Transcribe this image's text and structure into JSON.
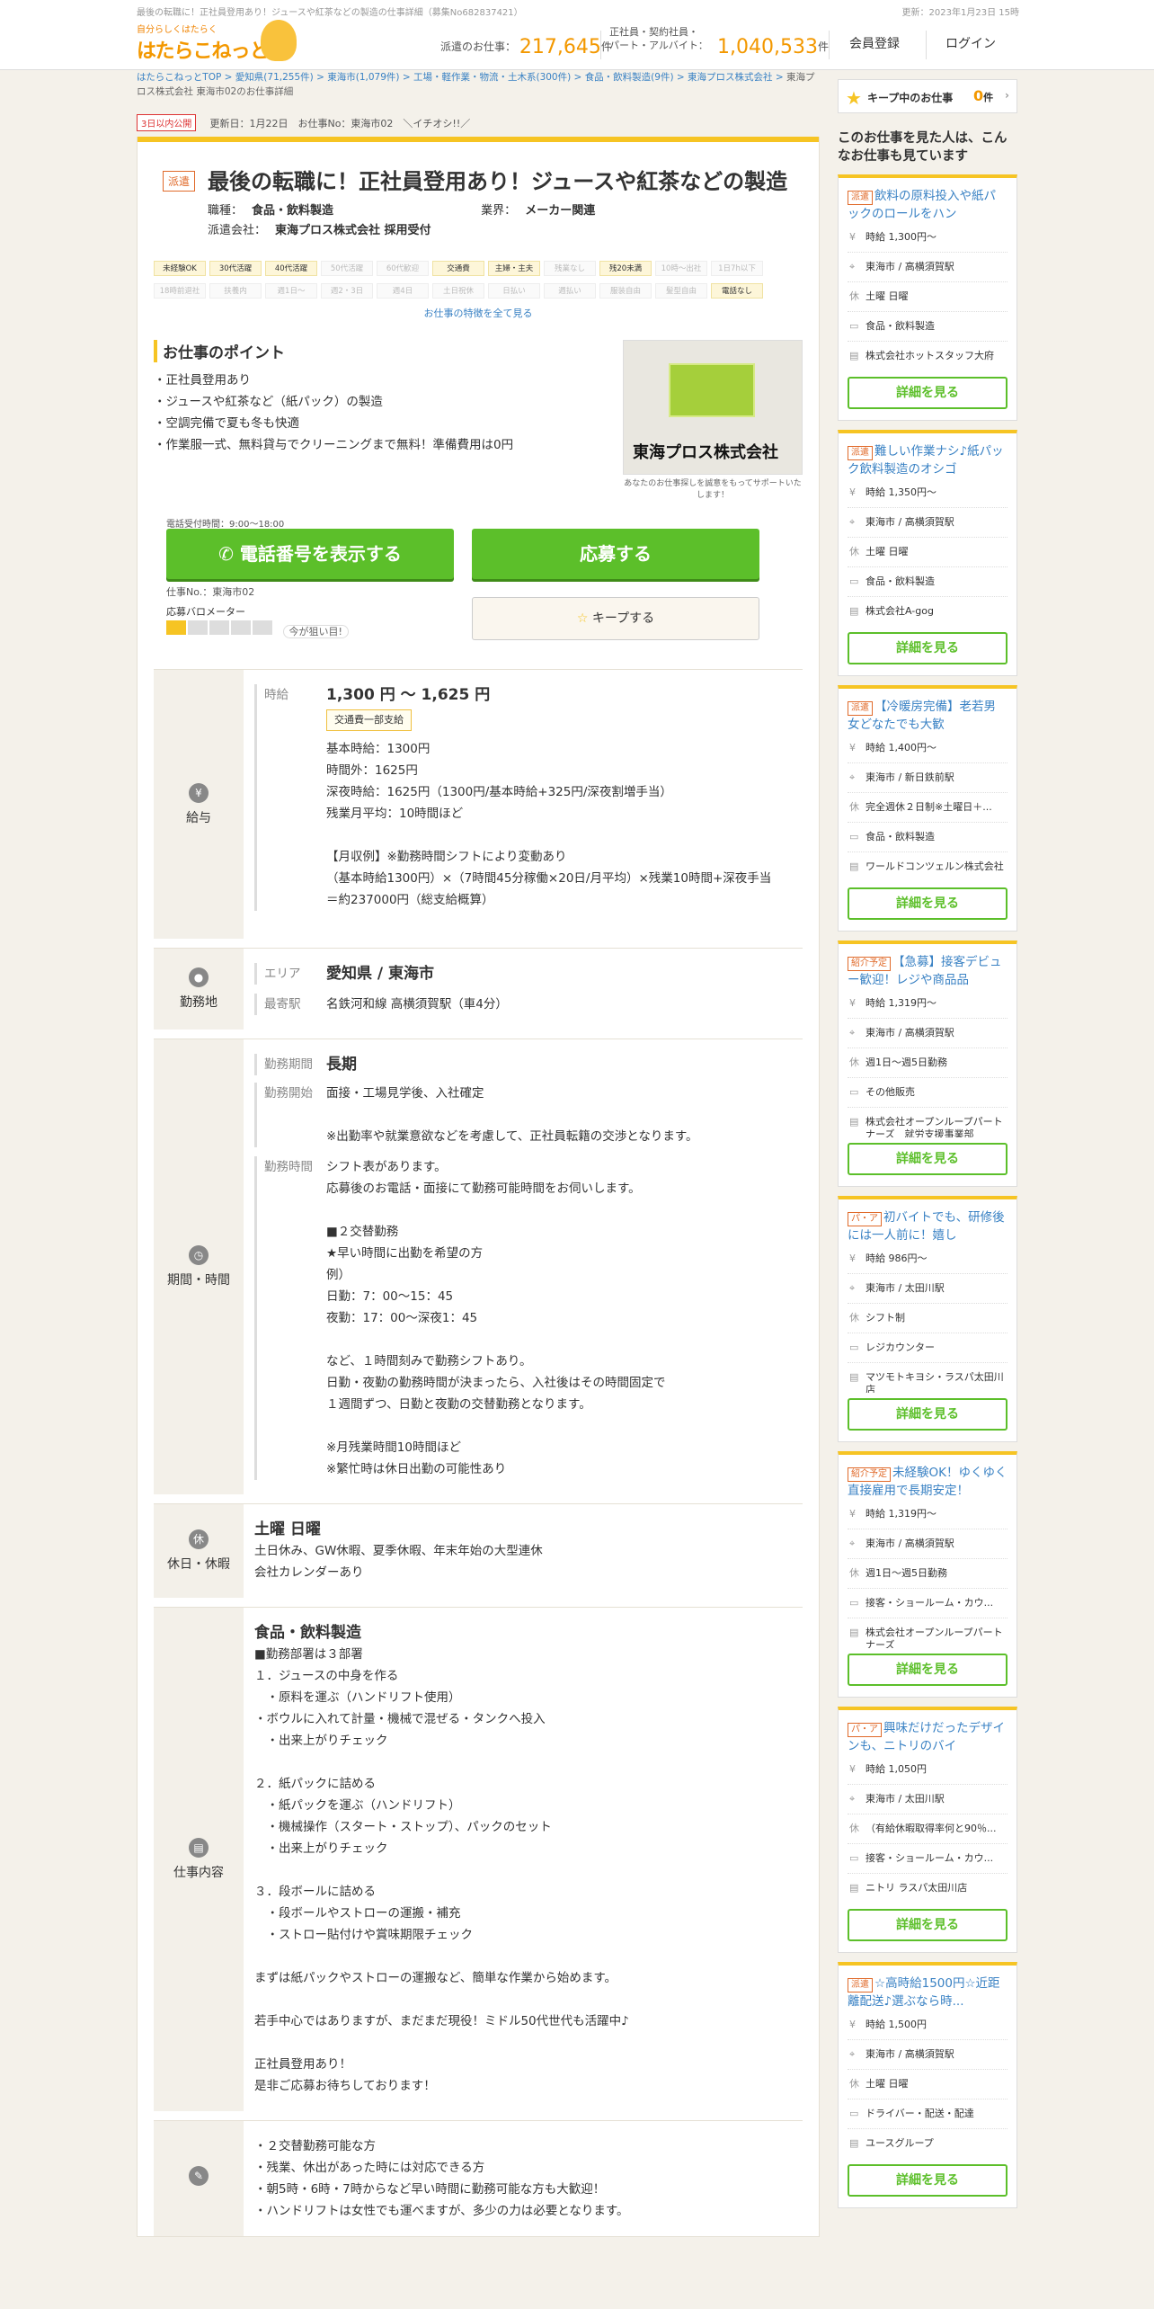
{
  "topbar": {
    "left": "最後の転職に！正社員登用あり！ジュースや紅茶などの製造の仕事詳細（募集No682837421）",
    "right": "更新：2023年1月23日 15時"
  },
  "header": {
    "logo_small": "自分らしくはたらく",
    "logo": "はたらこねっと",
    "haken_label": "派遣のお仕事：",
    "haken_num": "217,645",
    "unit": "件",
    "seishain_label1": "正社員・契約社員・",
    "seishain_label2": "パート・アルバイト：",
    "seishain_num": "1,040,533",
    "register": "会員登録",
    "login": "ログイン"
  },
  "breadcrumb": {
    "links": [
      "はたらこねっとTOP",
      "愛知県(71,255件)",
      "東海市(1,079件)",
      "工場・軽作業・物流・土木系(300件)",
      "食品・飲料製造(9件)",
      "東海プロス株式会社",
      "東海プロス株式会社 東海市02のお仕事詳細"
    ],
    "sep": " > "
  },
  "job": {
    "newtag": "3日以内公開",
    "updated": "更新日：1月22日　お仕事No：東海市02　＼イチオシ!!／",
    "kind": "派遣",
    "title": "最後の転職に！正社員登用あり！ジュースや紅茶などの製造",
    "job_label": "職種：",
    "job_value": "食品・飲料製造",
    "industry_label": "業界：",
    "industry_value": "メーカー関連",
    "company_label": "派遣会社：",
    "company_value": "東海プロス株式会社 採用受付",
    "features": [
      [
        "未経験OK",
        1
      ],
      [
        "30代活躍",
        1
      ],
      [
        "40代活躍",
        1
      ],
      [
        "50代活躍",
        0
      ],
      [
        "60代歓迎",
        0
      ],
      [
        "交通費",
        1
      ],
      [
        "主婦・主夫",
        1
      ],
      [
        "残業なし",
        0
      ],
      [
        "残20未満",
        1
      ],
      [
        "10時～出社",
        0
      ],
      [
        "1日7h以下",
        0
      ],
      [
        "18時前退社",
        0
      ],
      [
        "扶養内",
        0
      ],
      [
        "週1日～",
        0
      ],
      [
        "週2・3日",
        0
      ],
      [
        "週4日",
        0
      ],
      [
        "土日祝休",
        0
      ],
      [
        "日払い",
        0
      ],
      [
        "週払い",
        0
      ],
      [
        "服装自由",
        0
      ],
      [
        "髪型自由",
        0
      ],
      [
        "電話なし",
        1
      ]
    ],
    "more": "お仕事の特徴を全て見る",
    "point_title": "お仕事のポイント",
    "points": [
      "・正社員登用あり",
      "・ジュースや紅茶など（紙パック）の製造",
      "・空調完備で夏も冬も快適",
      "・作業服一式、無料貸与でクリーニングまで無料！準備費用は0円"
    ],
    "comp_logo_text": "東海プロス株式会社",
    "comp_caption": "あなたのお仕事探しを誠意をもってサポートいたします！",
    "tel_hours": "電話受付時間：9:00～18:00",
    "tel_btn": "電話番号を表示する",
    "apply_btn": "応募する",
    "jobno": "仕事No.：東海市02",
    "baro_label": "応募バロメーター",
    "baro_level": 1,
    "baro_note": "今が狙い目!",
    "keep_btn": "キープする"
  },
  "sections": {
    "salary": {
      "head": "給与",
      "lab": "時給",
      "range": "1,300 円 ～ 1,625 円",
      "pill": "交通費一部支給",
      "lines": [
        "基本時給：1300円",
        "時間外：1625円",
        "深夜時給：1625円（1300円/基本時給+325円/深夜割増手当）",
        "残業月平均：10時間ほど",
        "",
        "【月収例】※勤務時間シフトにより変動あり",
        "（基本時給1300円）×（7時間45分稼働×20日/月平均）×残業10時間+深夜手当",
        "＝約237000円（総支給概算）"
      ]
    },
    "place": {
      "head": "勤務地",
      "lab1": "エリア",
      "area": "愛知県 / 東海市",
      "lab2": "最寄駅",
      "station": "名鉄河和線 高横須賀駅（車4分）"
    },
    "period": {
      "head": "期間・時間",
      "lab1": "勤務期間",
      "term": "長期",
      "lab2": "勤務開始",
      "start": [
        "面接・工場見学後、入社確定",
        "",
        "※出勤率や就業意欲などを考慮して、正社員転籍の交渉となります。"
      ],
      "lab3": "勤務時間",
      "hours": [
        "シフト表があります。",
        "応募後のお電話・面接にて勤務可能時間をお伺いします。",
        "",
        "■２交替勤務",
        "★早い時間に出勤を希望の方",
        "例）",
        "日勤：7：00～15：45",
        "夜勤：17：00～深夜1：45",
        "",
        "など、１時間刻みで勤務シフトあり。",
        "日勤・夜勤の勤務時間が決まったら、入社後はその時間固定で",
        "１週間ずつ、日勤と夜勤の交替勤務となります。",
        "",
        "※月残業時間10時間ほど",
        "※繁忙時は休日出勤の可能性あり"
      ]
    },
    "holiday": {
      "head": "休日・休暇",
      "icon": "休",
      "title": "土曜 日曜",
      "lines": [
        "土日休み、GW休暇、夏季休暇、年末年始の大型連休",
        "会社カレンダーあり"
      ]
    },
    "work": {
      "head": "仕事内容",
      "title": "食品・飲料製造",
      "lines": [
        "■勤務部署は３部署",
        "１．ジュースの中身を作る",
        "　・原料を運ぶ（ハンドリフト使用）",
        "・ボウルに入れて計量・機械で混ぜる・タンクへ投入",
        "　・出来上がりチェック",
        "",
        "２．紙パックに詰める",
        "　・紙パックを運ぶ（ハンドリフト）",
        "　・機械操作（スタート・ストップ）、パックのセット",
        "　・出来上がりチェック",
        "",
        "３．段ボールに詰める",
        "　・段ボールやストローの運搬・補充",
        "　・ストロー貼付けや賞味期限チェック",
        "",
        "まずは紙パックやストローの運搬など、簡単な作業から始めます。",
        "",
        "若手中心ではありますが、まだまだ現役！ミドル50代世代も活躍中♪",
        "",
        "正社員登用あり！",
        "是非ご応募お待ちしております！"
      ]
    },
    "extra": {
      "lines": [
        "・２交替勤務可能な方",
        "・残業、休出があった時には対応できる方",
        "・朝5時・6時・7時からなど早い時間に勤務可能な方も大歓迎！",
        "・ハンドリフトは女性でも運べますが、多少の力は必要となります。"
      ]
    }
  },
  "side": {
    "keep_label": "キープ中のお仕事",
    "keep_num": "0",
    "keep_unit": "件",
    "head": "このお仕事を見た人は、こんなお仕事も見ています",
    "detail": "詳細を見る",
    "cards": [
      {
        "tag": "派遣",
        "title": "飲料の原料投入や紙パックのロールをハン",
        "wage": "時給 1,300円～",
        "place": "東海市 / 高横須賀駅",
        "hol": "土曜 日曜",
        "job": "食品・飲料製造",
        "co": "株式会社ホットスタッフ大府"
      },
      {
        "tag": "派遣",
        "title": "難しい作業ナシ♪紙パック飲料製造のオシゴ",
        "wage": "時給 1,350円～",
        "place": "東海市 / 高横須賀駅",
        "hol": "土曜 日曜",
        "job": "食品・飲料製造",
        "co": "株式会社A-gog"
      },
      {
        "tag": "派遣",
        "title": "【冷暖房完備】老若男女どなたでも大歓",
        "wage": "時給 1,400円～",
        "place": "東海市 / 新日鉄前駅",
        "hol": "完全週休２日制※土曜日＋...",
        "job": "食品・飲料製造",
        "co": "ワールドコンツェルン株式会社"
      },
      {
        "tag": "紹介予定",
        "title": "【急募】接客デビュー歓迎！レジや商品品",
        "wage": "時給 1,319円～",
        "place": "東海市 / 高横須賀駅",
        "hol": "週1日～週5日勤務",
        "job": "その他販売",
        "co": "株式会社オープンループパートナーズ　就労支援事業部"
      },
      {
        "tag": "パ・ア",
        "title": "初バイトでも、研修後には一人前に！嬉し",
        "wage": "時給 986円～",
        "place": "東海市 / 太田川駅",
        "hol": "シフト制",
        "job": "レジカウンター",
        "co": "マツモトキヨシ・ラスパ太田川店"
      },
      {
        "tag": "紹介予定",
        "title": "未経験OK！ゆくゆく直接雇用で長期安定！",
        "wage": "時給 1,319円～",
        "place": "東海市 / 高横須賀駅",
        "hol": "週1日～週5日勤務",
        "job": "接客・ショールーム・カウ...",
        "co": "株式会社オープンループパートナーズ"
      },
      {
        "tag": "パ・ア",
        "title": "興味だけだったデザインも、ニトリのバイ",
        "wage": "時給 1,050円",
        "place": "東海市 / 太田川駅",
        "hol": "（有給休暇取得率何と90％...",
        "job": "接客・ショールーム・カウ...",
        "co": "ニトリ ラスパ太田川店"
      },
      {
        "tag": "派遣",
        "title": "☆高時給1500円☆近距離配送♪選ぶなら時...",
        "wage": "時給 1,500円",
        "place": "東海市 / 高横須賀駅",
        "hol": "土曜 日曜",
        "job": "ドライバー・配送・配達",
        "co": "ユースグループ"
      }
    ]
  }
}
